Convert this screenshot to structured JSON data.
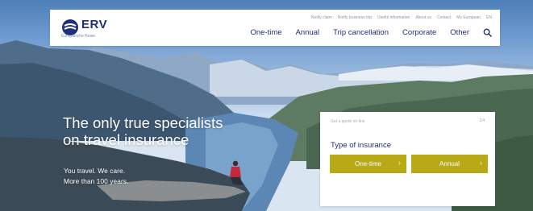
{
  "header": {
    "logo_text": "ERV",
    "logo_sub": "Europäische Reise",
    "utility_links": [
      "Notify claim",
      "Notify business trip",
      "Useful information",
      "About us",
      "Contact",
      "My European",
      "EN"
    ],
    "main_nav": [
      "One-time",
      "Annual",
      "Trip cancellation",
      "Corporate",
      "Other"
    ]
  },
  "hero": {
    "headline_line1": "The only true specialists",
    "headline_line2": "on travel insurance",
    "tagline_line1": "You travel. We care.",
    "tagline_line2": "More than 100 years."
  },
  "quote_box": {
    "top_label": "Get a quote on-line",
    "step": "1/4",
    "title": "Type of insurance",
    "buttons": [
      "One-time",
      "Annual"
    ]
  },
  "colors": {
    "brand_navy": "#1f2f7a",
    "button_olive": "#b8a916"
  },
  "icons": [
    "erv-logo-icon",
    "search-icon",
    "chevron-right-icon"
  ]
}
